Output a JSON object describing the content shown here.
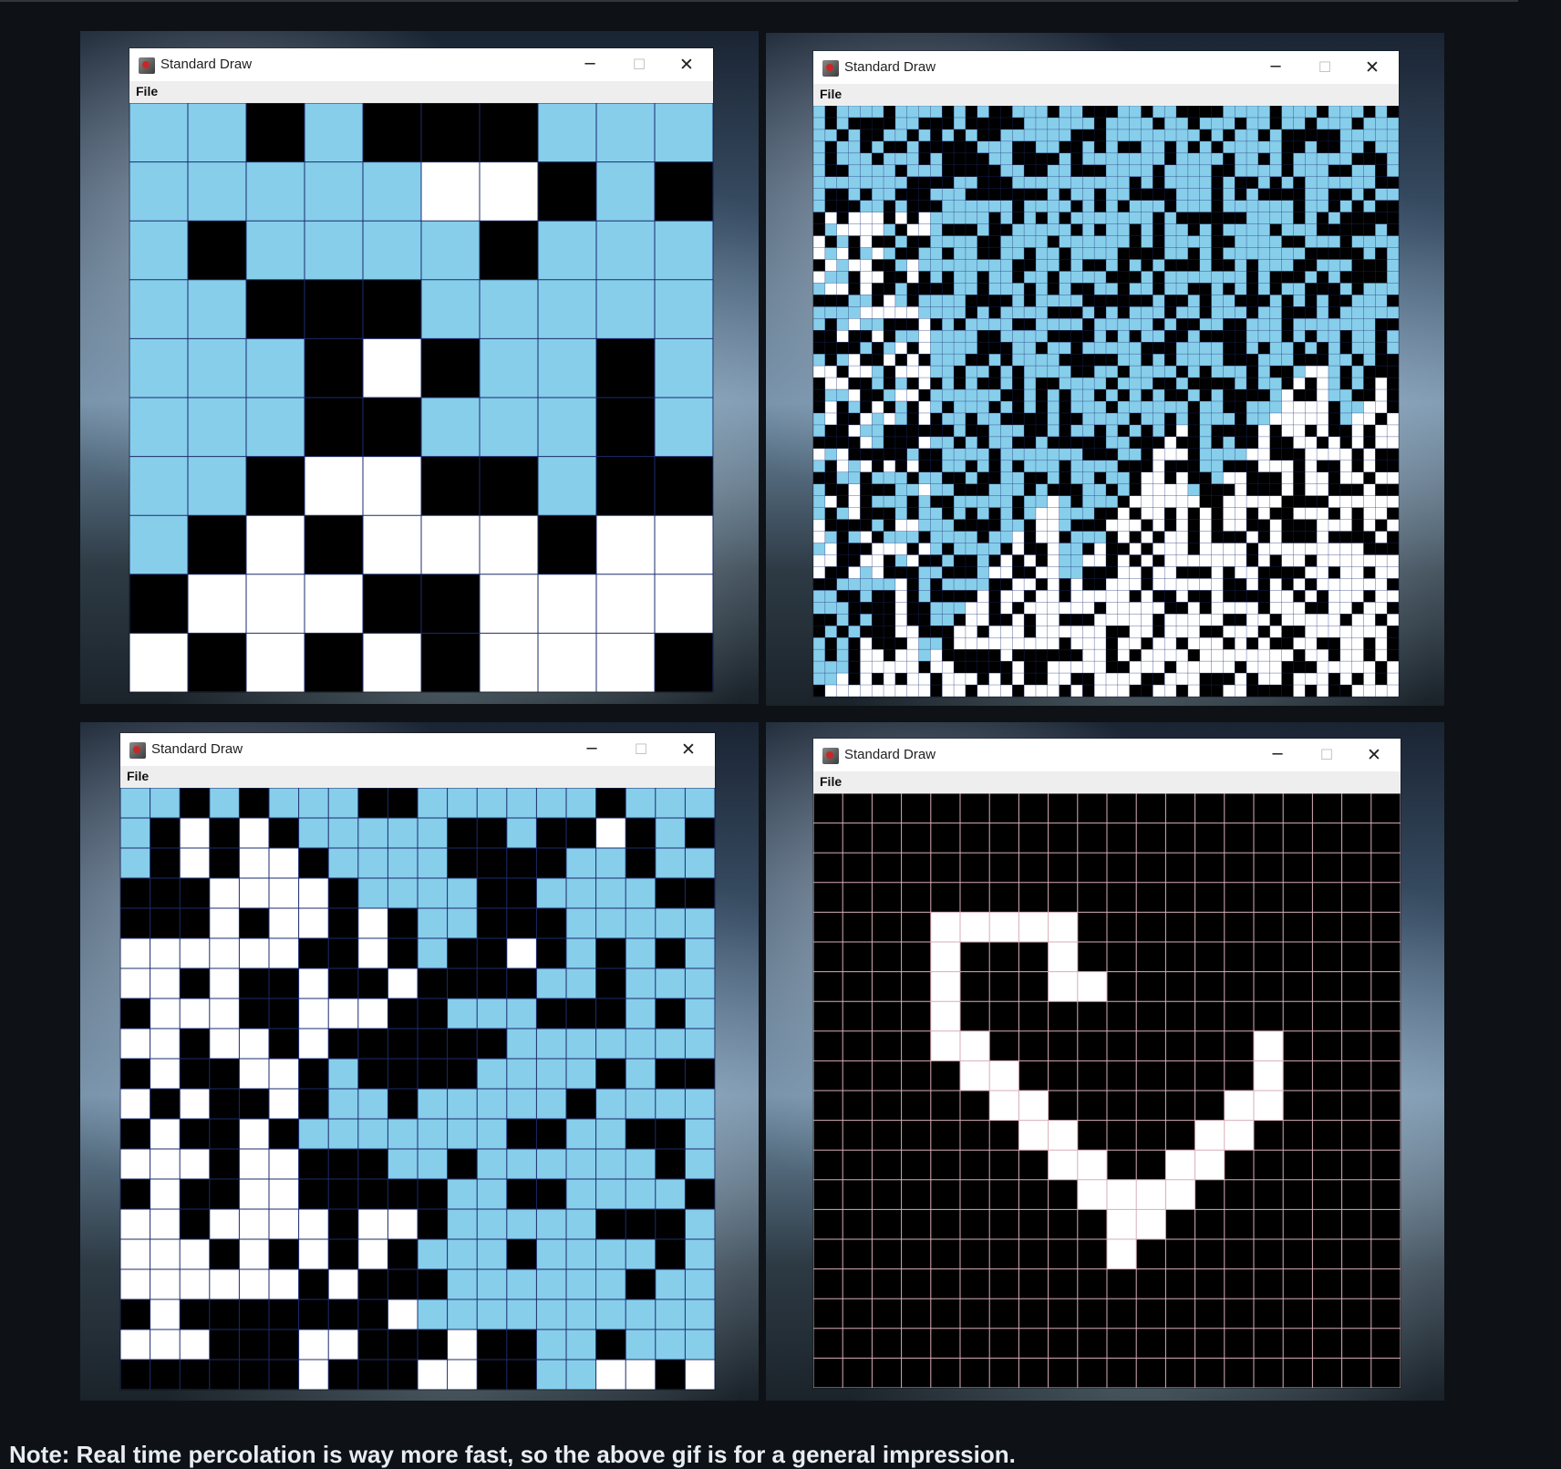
{
  "page": {
    "footer_text": "Note: Real time percolation is way more fast, so the above gif is for a general impression."
  },
  "colors": {
    "open_full": "#87CEEB",
    "open_empty": "#FFFFFF",
    "blocked": "#000000",
    "grid_line": "#1b2b6e",
    "pink_grid": "#d9aeb8"
  },
  "windows": [
    {
      "title": "Standard Draw",
      "menu": [
        "File"
      ],
      "controls": {
        "minimize": "─",
        "maximize": "☐",
        "close": "✕"
      },
      "grid_size": 10,
      "rows": [
        "FFBFBBBFFF",
        "FFFFFWWBFB",
        "FBFFFFBFFF",
        "FFBBBFFFFF",
        "FFFBWBFFBF",
        "FFFBBFFFBF",
        "FFBWWBBFBB",
        "FBWBWWWBWW",
        "BWWWBBWWWW",
        "WBWBWBWWWB"
      ]
    },
    {
      "title": "Standard Draw",
      "menu": [
        "File"
      ],
      "controls": {
        "minimize": "─",
        "maximize": "☐",
        "close": "✕"
      },
      "grid_size": 50,
      "fill_fraction": 0.58
    },
    {
      "title": "Standard Draw",
      "menu": [
        "File"
      ],
      "controls": {
        "minimize": "─",
        "maximize": "☐",
        "close": "✕"
      },
      "grid_size": 20,
      "rows": [
        "FFBFBFFFBBFFFFFFBFFF",
        "FBWBWBFFFFFBBFBBWBFB",
        "FBWBWWBFFFFBBBBFFBFF",
        "BBBWWWWBFFFFBBFFFFBB",
        "BBBWBWWBWBFFBBBFFFFF",
        "WWWWWWBBWBFBBWBFBFBF",
        "WWBWBBWBBWBBBBFFBFFF",
        "BWWWBBWWWBBFFFBBBFBF",
        "WWBWWBWBBBBBBFFFFFFF",
        "BWBBWWBFBBBBFFFFBFBB",
        "WBWBBWBFFBFFFFFBFFFF",
        "BWBBWBFFFFFFFBBFFBBF",
        "WWWBWWBBBFFBFFFFFFBF",
        "BWBBWWBBBBBFFBBFFFFB",
        "WWBWWWWBWWBFFFFFBBBF",
        "WWWBWBWBWBFFFBFFFFBF",
        "WWWWWWBWBBBFFFFFFBFF",
        "BWBBBBBBBWFFFFFFFFFF",
        "WWWBBBWWBBBWBBFFBFFF",
        "BBBBBBWBBBWWBBFFWWBW"
      ]
    },
    {
      "title": "Standard Draw",
      "menu": [
        "File"
      ],
      "controls": {
        "minimize": "─",
        "maximize": "☐",
        "close": "✕"
      },
      "grid_size": 20,
      "rows": [
        "BBBBBBBBBBBBBBBBBBBB",
        "BBBBBBBBBBBBBBBBBBBB",
        "BBBBBBBBBBBBBBBBBBBB",
        "BBBBBBBBBBBBBBBBBBBB",
        "BBBBWWWWWBBBBBBBBBBB",
        "BBBBWBBBWBBBBBBBBBBB",
        "BBBBWBBBWWBBBBBBBBBB",
        "BBBBWBBBBBBBBBBBBBBB",
        "BBBBWWBBBBBBBBBWBBBB",
        "BBBBBWWBBBBBBBBWBBBB",
        "BBBBBBWWBBBBBBWWBBBB",
        "BBBBBBBWWBBBBWWBBBBB",
        "BBBBBBBBWWBBWWBBBBBB",
        "BBBBBBBBBWWWWBBBBBBB",
        "BBBBBBBBBBWWBBBBBBBB",
        "BBBBBBBBBBWBBBBBBBBB",
        "BBBBBBBBBBBBBBBBBBBB",
        "BBBBBBBBBBBBBBBBBBBB",
        "BBBBBBBBBBBBBBBBBBBB",
        "BBBBBBBBBBBBBBBBBBBB"
      ]
    }
  ]
}
